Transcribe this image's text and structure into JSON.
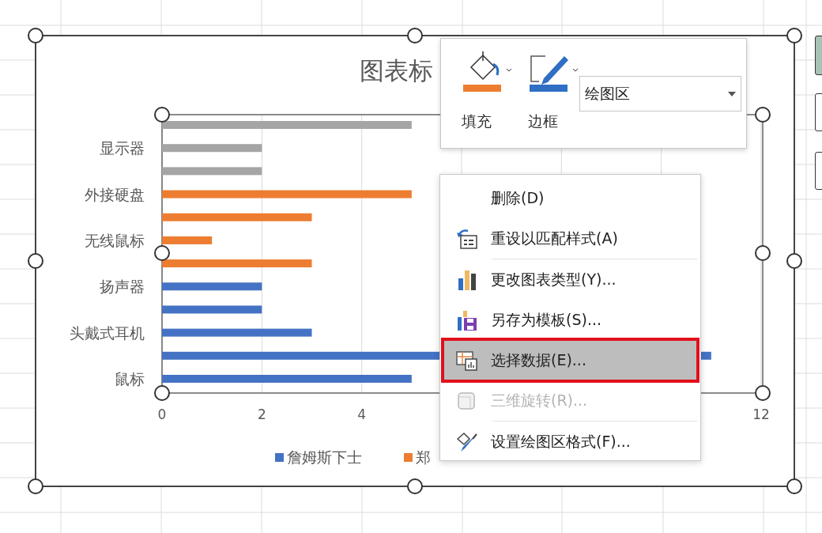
{
  "chart": {
    "chart_data": {
      "type": "bar",
      "orientation": "horizontal",
      "title": "图表标",
      "categories": [
        null,
        "显示器",
        null,
        "外接硬盘",
        null,
        "无线鼠标",
        null,
        "扬声器",
        null,
        "头戴式耳机",
        null,
        "鼠标"
      ],
      "series": [
        {
          "name": "詹姆斯下士",
          "color": "#4472c4",
          "values": [
            null,
            null,
            null,
            null,
            null,
            null,
            null,
            2,
            2,
            3,
            11,
            5
          ]
        },
        {
          "name": "郑",
          "color": "#ed7d31",
          "values": [
            null,
            null,
            null,
            5,
            3,
            1,
            3,
            null,
            null,
            null,
            null,
            null
          ]
        },
        {
          "color": "#a5a5a5",
          "values": [
            5,
            2,
            2,
            null,
            null,
            null,
            null,
            null,
            null,
            null,
            null,
            null
          ]
        }
      ],
      "xlim": [
        0,
        12
      ],
      "xticks": [
        0,
        2,
        4,
        12
      ],
      "legend": "bottom"
    }
  },
  "toolbar": {
    "buttons": [
      {
        "kind": "fill",
        "label": "填充"
      },
      {
        "kind": "border",
        "label": "边框"
      }
    ],
    "selector": {
      "value": "绘图区"
    }
  },
  "context_menu": {
    "items": [
      {
        "kind": "item",
        "label": "删除(D)",
        "selected": false,
        "disabled": false
      },
      {
        "kind": "item",
        "label": "重设以匹配样式(A)",
        "selected": false,
        "disabled": false
      },
      {
        "kind": "separator"
      },
      {
        "kind": "item",
        "label": "更改图表类型(Y)...",
        "selected": false,
        "disabled": false
      },
      {
        "kind": "item",
        "label": "另存为模板(S)...",
        "selected": false,
        "disabled": false
      },
      {
        "kind": "item",
        "label": "选择数据(E)...",
        "selected": true,
        "disabled": false
      },
      {
        "kind": "item",
        "label": "三维旋转(R)...",
        "selected": false,
        "disabled": true
      },
      {
        "kind": "separator"
      },
      {
        "kind": "item",
        "label": "设置绘图区格式(F)...",
        "selected": false,
        "disabled": false
      }
    ]
  }
}
